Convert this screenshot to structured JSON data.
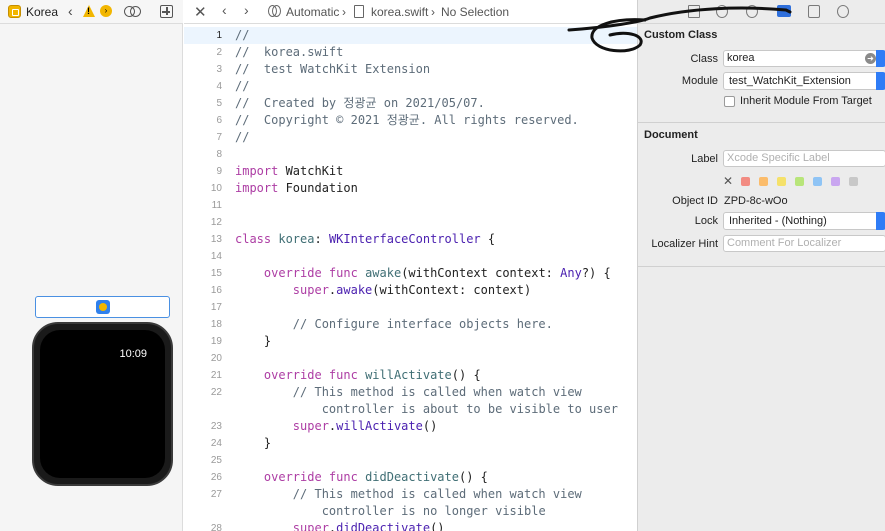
{
  "storyboard": {
    "scene_title": "Korea",
    "watch_time": "10:09"
  },
  "editor": {
    "jumpbar": {
      "mode": "Automatic",
      "file": "korea.swift",
      "selection": "No Selection"
    },
    "lines": [
      {
        "n": "1",
        "current": true,
        "parts": [
          [
            "cm",
            "//"
          ]
        ]
      },
      {
        "n": "2",
        "parts": [
          [
            "cm",
            "//  korea.swift"
          ]
        ]
      },
      {
        "n": "3",
        "parts": [
          [
            "cm",
            "//  test WatchKit Extension"
          ]
        ]
      },
      {
        "n": "4",
        "parts": [
          [
            "cm",
            "//"
          ]
        ]
      },
      {
        "n": "5",
        "parts": [
          [
            "cm",
            "//  Created by 정광균 on 2021/05/07."
          ]
        ]
      },
      {
        "n": "6",
        "parts": [
          [
            "cm",
            "//  Copyright © 2021 정광균. All rights reserved."
          ]
        ]
      },
      {
        "n": "7",
        "parts": [
          [
            "cm",
            "//"
          ]
        ]
      },
      {
        "n": "8",
        "parts": []
      },
      {
        "n": "9",
        "parts": [
          [
            "kw",
            "import"
          ],
          [
            "pl",
            " WatchKit"
          ]
        ]
      },
      {
        "n": "10",
        "parts": [
          [
            "kw",
            "import"
          ],
          [
            "pl",
            " Foundation"
          ]
        ]
      },
      {
        "n": "11",
        "parts": []
      },
      {
        "n": "12",
        "parts": []
      },
      {
        "n": "13",
        "parts": [
          [
            "kw",
            "class"
          ],
          [
            "pl",
            " "
          ],
          [
            "fn",
            "korea"
          ],
          [
            "pl",
            ": "
          ],
          [
            "ty",
            "WKInterfaceController"
          ],
          [
            "pl",
            " {"
          ]
        ]
      },
      {
        "n": "14",
        "parts": []
      },
      {
        "n": "15",
        "parts": [
          [
            "pl",
            "    "
          ],
          [
            "kw",
            "override func"
          ],
          [
            "pl",
            " "
          ],
          [
            "fn",
            "awake"
          ],
          [
            "pl",
            "(withContext context: "
          ],
          [
            "ty",
            "Any"
          ],
          [
            "pl",
            "?) {"
          ]
        ]
      },
      {
        "n": "16",
        "parts": [
          [
            "pl",
            "        "
          ],
          [
            "kw",
            "super"
          ],
          [
            "pl",
            "."
          ],
          [
            "ty",
            "awake"
          ],
          [
            "pl",
            "(withContext: context)"
          ]
        ]
      },
      {
        "n": "17",
        "parts": []
      },
      {
        "n": "18",
        "parts": [
          [
            "pl",
            "        "
          ],
          [
            "cm",
            "// Configure interface objects here."
          ]
        ]
      },
      {
        "n": "19",
        "parts": [
          [
            "pl",
            "    }"
          ]
        ]
      },
      {
        "n": "20",
        "parts": []
      },
      {
        "n": "21",
        "parts": [
          [
            "pl",
            "    "
          ],
          [
            "kw",
            "override func"
          ],
          [
            "pl",
            " "
          ],
          [
            "fn",
            "willActivate"
          ],
          [
            "pl",
            "() {"
          ]
        ]
      },
      {
        "n": "22",
        "parts": [
          [
            "pl",
            "        "
          ],
          [
            "cm",
            "// This method is called when watch view"
          ]
        ]
      },
      {
        "n": "",
        "parts": [
          [
            "pl",
            "            "
          ],
          [
            "cm",
            "controller is about to be visible to user"
          ]
        ]
      },
      {
        "n": "23",
        "parts": [
          [
            "pl",
            "        "
          ],
          [
            "kw",
            "super"
          ],
          [
            "pl",
            "."
          ],
          [
            "ty",
            "willActivate"
          ],
          [
            "pl",
            "()"
          ]
        ]
      },
      {
        "n": "24",
        "parts": [
          [
            "pl",
            "    }"
          ]
        ]
      },
      {
        "n": "25",
        "parts": []
      },
      {
        "n": "26",
        "parts": [
          [
            "pl",
            "    "
          ],
          [
            "kw",
            "override func"
          ],
          [
            "pl",
            " "
          ],
          [
            "fn",
            "didDeactivate"
          ],
          [
            "pl",
            "() {"
          ]
        ]
      },
      {
        "n": "27",
        "parts": [
          [
            "pl",
            "        "
          ],
          [
            "cm",
            "// This method is called when watch view"
          ]
        ]
      },
      {
        "n": "",
        "parts": [
          [
            "pl",
            "            "
          ],
          [
            "cm",
            "controller is no longer visible"
          ]
        ]
      },
      {
        "n": "28",
        "parts": [
          [
            "pl",
            "        "
          ],
          [
            "kw",
            "super"
          ],
          [
            "pl",
            "."
          ],
          [
            "ty",
            "didDeactivate"
          ],
          [
            "pl",
            "()"
          ]
        ]
      }
    ]
  },
  "inspector": {
    "custom_class": {
      "title": "Custom Class",
      "class_label": "Class",
      "class_value": "korea",
      "module_label": "Module",
      "module_value": "test_WatchKit_Extension",
      "inherit_label": "Inherit Module From Target"
    },
    "document": {
      "title": "Document",
      "label_label": "Label",
      "label_placeholder": "Xcode Specific Label",
      "object_id_label": "Object ID",
      "object_id_value": "ZPD-8c-wOo",
      "lock_label": "Lock",
      "lock_value": "Inherited - (Nothing)",
      "localizer_label": "Localizer Hint",
      "localizer_placeholder": "Comment For Localizer",
      "swatch_colors": [
        "#f28b82",
        "#fbbc6b",
        "#f5e16a",
        "#b8e57a",
        "#8fc4f5",
        "#c9a6f0",
        "#c8c8c8"
      ]
    }
  },
  "colors": {
    "accent": "#2f7cf6",
    "annotation_stroke": "#111111"
  }
}
